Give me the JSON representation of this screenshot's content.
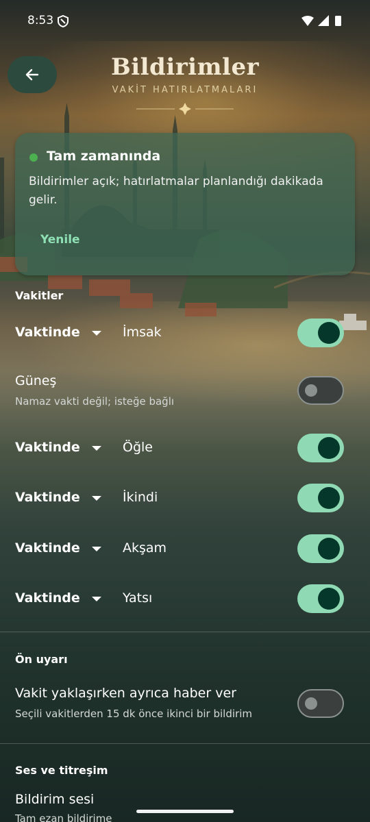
{
  "status_bar": {
    "time": "8:53"
  },
  "header": {
    "title": "Bildirimler",
    "subtitle": "VAKİT HATIRLATMALARI"
  },
  "status_card": {
    "title": "Tam zamanında",
    "body": "Bildirimler açık; hatırlatmalar planlandığı dakikada gelir.",
    "button": "Yenile"
  },
  "prayer_section": {
    "title": "Vakitler",
    "rows": [
      {
        "timing": "Vaktinde",
        "name": "İmsak",
        "enabled": true
      },
      {
        "name": "Güneş",
        "note": "Namaz vakti değil; isteğe bağlı",
        "enabled": false
      },
      {
        "timing": "Vaktinde",
        "name": "Öğle",
        "enabled": true
      },
      {
        "timing": "Vaktinde",
        "name": "İkindi",
        "enabled": true
      },
      {
        "timing": "Vaktinde",
        "name": "Akşam",
        "enabled": true
      },
      {
        "timing": "Vaktinde",
        "name": "Yatsı",
        "enabled": true
      }
    ]
  },
  "pre_alert": {
    "title": "Ön uyarı",
    "label": "Vakit yaklaşırken ayrıca haber ver",
    "description": "Seçili vakitlerden 15 dk önce ikinci bir bildirim",
    "enabled": false
  },
  "sound_section": {
    "title": "Ses ve titreşim",
    "label": "Bildirim sesi",
    "description": "Tam ezan bildirime"
  },
  "colors": {
    "accent": "#8fd9b4",
    "toggle_knob_on": "#06372b",
    "status_dot": "#4caf50",
    "card_bg": "#3e6854"
  }
}
